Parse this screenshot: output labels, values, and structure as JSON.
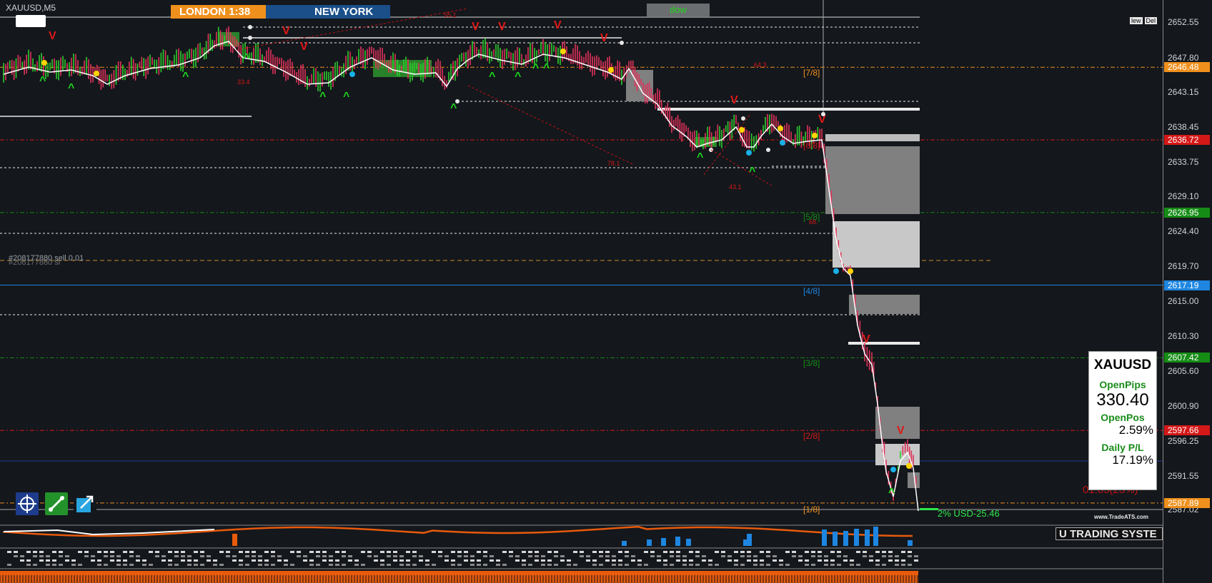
{
  "window": {
    "symbol_timeframe": "XAUUSD,M5"
  },
  "sessions": {
    "london": "LONDON 1:38",
    "new_york": "NEW YORK"
  },
  "dow_label": "dow",
  "top_buttons": [
    "lew",
    "Del"
  ],
  "order_label": "#208177880 sell 0.01",
  "order_label_2": "#208177880 sl",
  "price_axis": {
    "ticks": [
      "2652.55",
      "2647.80",
      "2643.15",
      "2638.45",
      "2633.75",
      "2629.10",
      "2624.40",
      "2619.70",
      "2615.00",
      "2610.30",
      "2605.60",
      "2600.90",
      "2596.25",
      "2591.55",
      "2587.02"
    ],
    "tags": [
      {
        "value": "2646.48",
        "color": "#f0901c"
      },
      {
        "value": "2636.72",
        "color": "#d41818"
      },
      {
        "value": "2626.95",
        "color": "#158c15"
      },
      {
        "value": "2617.19",
        "color": "#1e86e0"
      },
      {
        "value": "2607.42",
        "color": "#158c15"
      },
      {
        "value": "2597.66",
        "color": "#d41818"
      },
      {
        "value": "2587.89",
        "color": "#f0901c"
      }
    ]
  },
  "murrey_levels": [
    "[7/8]",
    "[6/8]",
    "[5/8]",
    "[4/8]",
    "[3/8]",
    "[2/8]",
    "[1/8]"
  ],
  "fib_labels": [
    "55.1",
    "64.3",
    "33.4",
    "78.1",
    "43.1",
    "68."
  ],
  "info_panel": {
    "symbol": "XAUUSD",
    "open_pips_label": "OpenPips",
    "open_pips_value": "330.40",
    "open_pos_label": "OpenPos",
    "open_pos_value": "2.59%",
    "daily_pl_label": "Daily P/L",
    "daily_pl_value": "17.19%"
  },
  "overlay_red_text": "01.05(23%)",
  "pl_text": "2% USD-25.46",
  "website": "www.TradeATS.com",
  "subwindow_title": "U TRADING SYSTE",
  "subwindow_scale": [
    "0",
    "0",
    "0",
    "0",
    "0",
    "0"
  ],
  "colors": {
    "background": "#14171c",
    "bull": "#2ecc2e",
    "bear": "#e0325a",
    "ma": "#ffffff"
  }
}
